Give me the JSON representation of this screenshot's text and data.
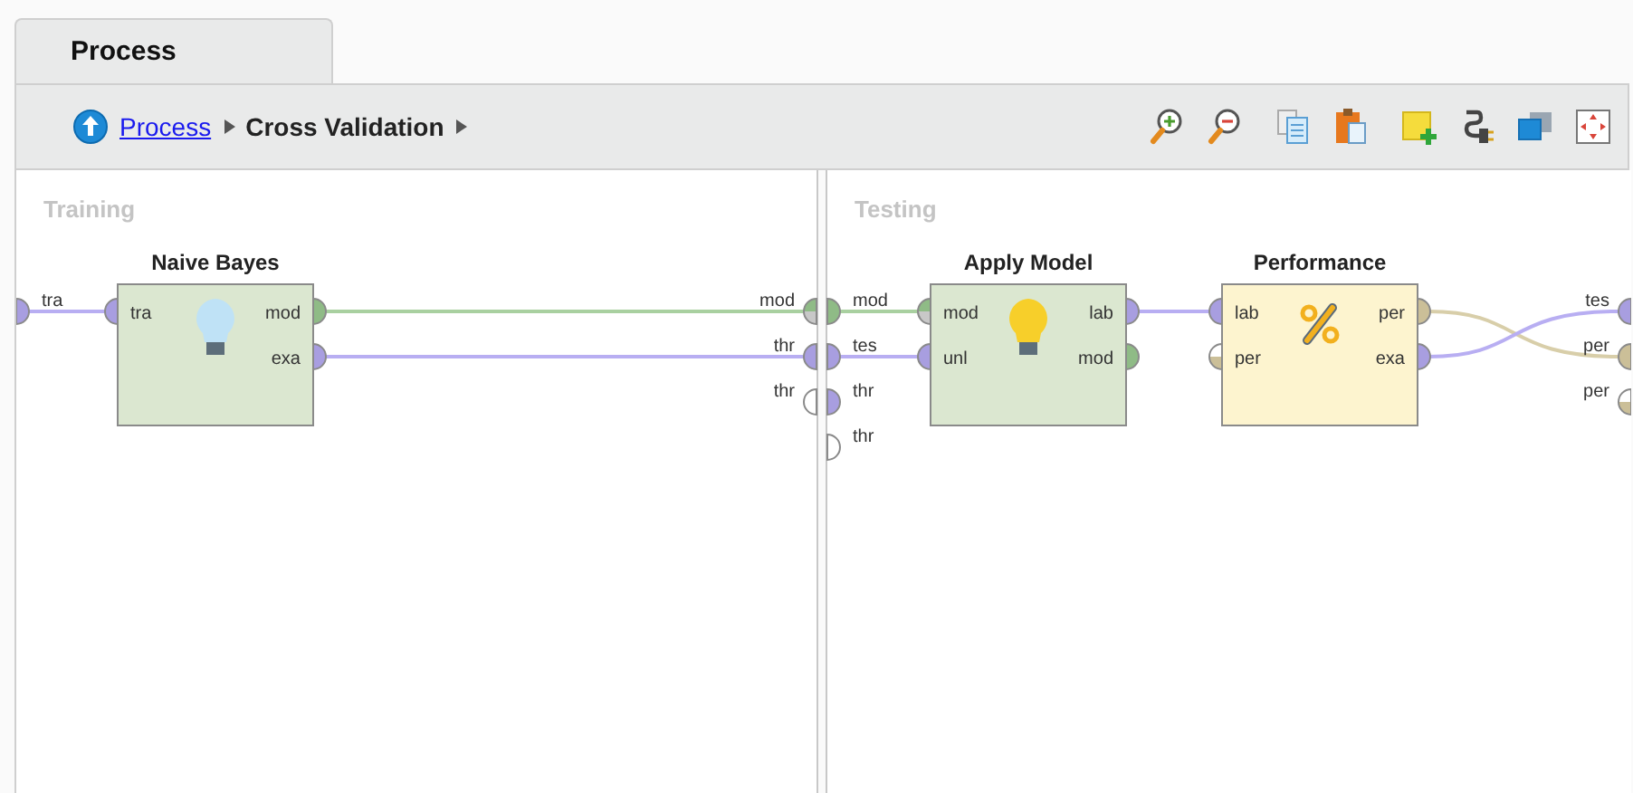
{
  "tab": {
    "label": "Process",
    "selected": true
  },
  "breadcrumb": {
    "link": "Process",
    "current": "Cross Validation"
  },
  "panels": [
    {
      "title": "Training",
      "sources": [
        {
          "label": "tra",
          "kind": "example",
          "half": false
        }
      ],
      "sinks": [
        {
          "label": "mod",
          "kind": "model",
          "half": true
        },
        {
          "label": "thr",
          "kind": "example",
          "half": false
        },
        {
          "label": "thr",
          "kind": "none",
          "half": false
        }
      ],
      "operators": [
        {
          "name": "Naive Bayes",
          "kind": "learner",
          "inputs": [
            {
              "label": "tra",
              "kind": "example",
              "half": false
            }
          ],
          "outputs": [
            {
              "label": "mod",
              "kind": "model",
              "half": false
            },
            {
              "label": "exa",
              "kind": "example",
              "half": false
            }
          ]
        }
      ]
    },
    {
      "title": "Testing",
      "sources": [
        {
          "label": "mod",
          "kind": "model",
          "half": false
        },
        {
          "label": "tes",
          "kind": "example",
          "half": false
        },
        {
          "label": "thr",
          "kind": "example",
          "half": false
        },
        {
          "label": "thr",
          "kind": "none",
          "half": false
        }
      ],
      "sinks": [
        {
          "label": "tes",
          "kind": "example",
          "half": false
        },
        {
          "label": "per",
          "kind": "performance",
          "half": false
        },
        {
          "label": "per",
          "kind": "performance",
          "half": true
        }
      ],
      "operators": [
        {
          "name": "Apply Model",
          "kind": "apply",
          "inputs": [
            {
              "label": "mod",
              "kind": "model",
              "half": true
            },
            {
              "label": "unl",
              "kind": "example",
              "half": false
            }
          ],
          "outputs": [
            {
              "label": "lab",
              "kind": "example",
              "half": false
            },
            {
              "label": "mod",
              "kind": "model",
              "half": false
            }
          ]
        },
        {
          "name": "Performance",
          "kind": "performance",
          "inputs": [
            {
              "label": "lab",
              "kind": "example",
              "half": false
            },
            {
              "label": "per",
              "kind": "performance",
              "half": true
            }
          ],
          "outputs": [
            {
              "label": "per",
              "kind": "performance",
              "half": false
            },
            {
              "label": "exa",
              "kind": "example",
              "half": false
            }
          ]
        }
      ]
    }
  ]
}
